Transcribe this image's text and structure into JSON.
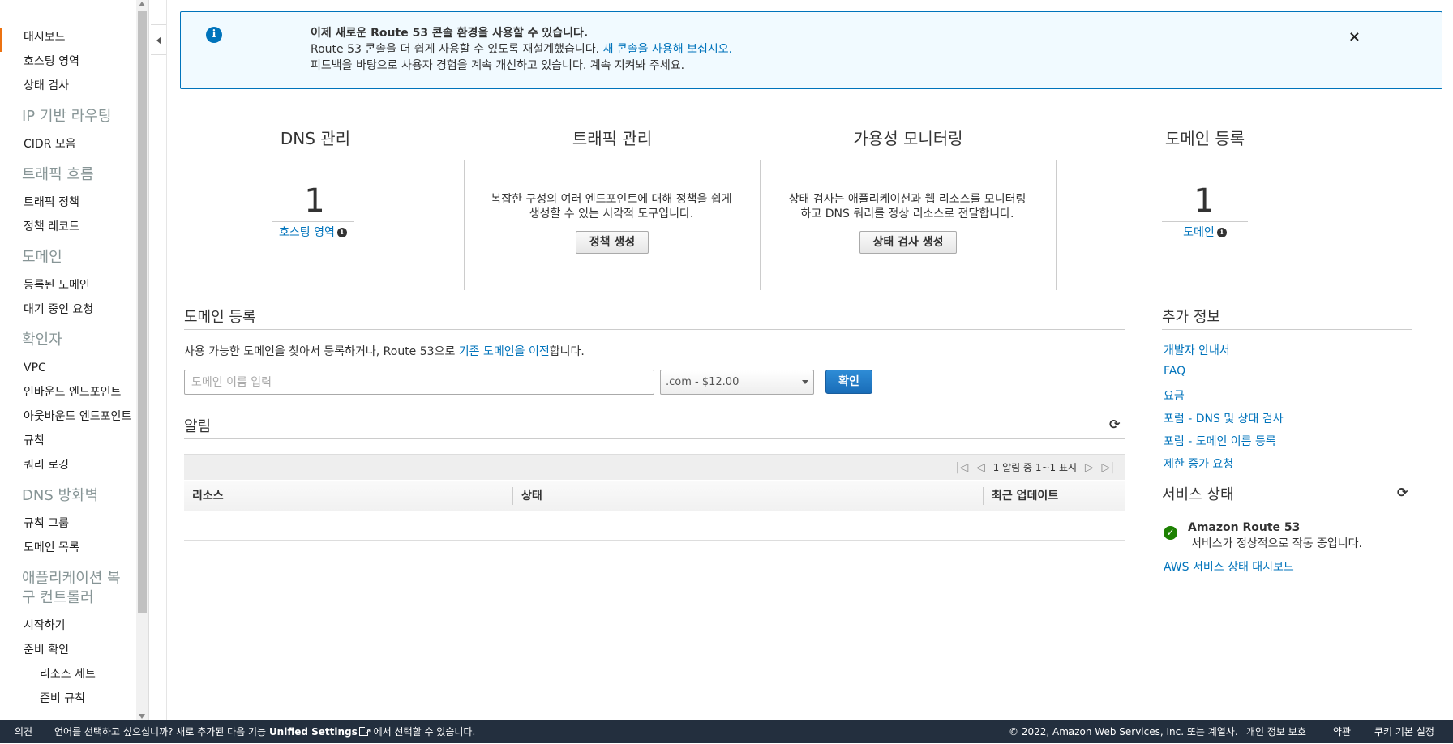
{
  "sidebar": {
    "dashboard": "대시보드",
    "hosted_zones": "호스팅 영역",
    "health_checks": "상태 검사",
    "sec_ip_routing": "IP 기반 라우팅",
    "cidr": "CIDR 모음",
    "sec_traffic_flow": "트래픽 흐름",
    "traffic_policies": "트래픽 정책",
    "policy_records": "정책 레코드",
    "sec_domains": "도메인",
    "registered_domains": "등록된 도메인",
    "pending_requests": "대기 중인 요청",
    "sec_resolver": "확인자",
    "vpc": "VPC",
    "inbound_endpoints": "인바운드 엔드포인트",
    "outbound_endpoints": "아웃바운드 엔드포인트",
    "rules": "규칙",
    "query_logging": "쿼리 로깅",
    "sec_dns_firewall": "DNS 방화벽",
    "rule_groups": "규칙 그룹",
    "domain_lists": "도메인 목록",
    "sec_arc": "애플리케이션 복구 컨트롤러",
    "getting_started": "시작하기",
    "readiness_check": "준비 확인",
    "resource_sets": "리소스 세트",
    "readiness_rules": "준비 규칙"
  },
  "banner": {
    "title": "이제 새로운 Route 53 콘솔 환경을 사용할 수 있습니다.",
    "line2_text": "Route 53 콘솔을 더 쉽게 사용할 수 있도록 재설계했습니다.",
    "line2_link": "새 콘솔을 사용해 보십시오.",
    "line3": "피드백을 바탕으로 사용자 경험을 계속 개선하고 있습니다. 계속 지켜봐 주세요.",
    "close": "×"
  },
  "features": {
    "dns": {
      "title": "DNS 관리",
      "count": "1",
      "link": "호스팅 영역"
    },
    "traffic": {
      "title": "트래픽 관리",
      "desc": "복잡한 구성의 여러 엔드포인트에 대해 정책을 쉽게 생성할 수 있는 시각적 도구입니다.",
      "button": "정책 생성"
    },
    "availability": {
      "title": "가용성 모니터링",
      "desc": "상태 검사는 애플리케이션과 웹 리소스를 모니터링하고 DNS 쿼리를 정상 리소스로 전달합니다.",
      "button": "상태 검사 생성"
    },
    "domain": {
      "title": "도메인 등록",
      "count": "1",
      "link": "도메인"
    }
  },
  "registration": {
    "title": "도메인 등록",
    "text_before": "사용 가능한 도메인을 찾아서 등록하거나, Route 53으로",
    "text_link": "기존 도메인을 이전",
    "text_after": "합니다.",
    "input_placeholder": "도메인 이름 입력",
    "tld_selected": ".com - $12.00",
    "confirm": "확인"
  },
  "alerts": {
    "title": "알림",
    "pager": "1 알림 중 1~1 표시",
    "columns": [
      "리소스",
      "상태",
      "최근 업데이트"
    ]
  },
  "more_info": {
    "title": "추가 정보",
    "links": [
      "개발자 안내서",
      "FAQ",
      "요금",
      "포럼 - DNS 및 상태 검사",
      "포럼 - 도메인 이름 등록",
      "제한 증가 요청"
    ]
  },
  "service_health": {
    "title": "서비스 상태",
    "service": "Amazon Route 53",
    "status": "서비스가 정상적으로 작동 중입니다.",
    "dashboard_link": "AWS 서비스 상태 대시보드"
  },
  "footer": {
    "feedback": "의견",
    "lang_text": "언어를 선택하고 싶으십니까? 새로 추가된 다음 기능",
    "unified": "Unified Settings",
    "lang_after": "에서 선택할 수 있습니다.",
    "copyright": "© 2022, Amazon Web Services, Inc. 또는 계열사.",
    "privacy": "개인 정보 보호",
    "terms": "약관",
    "cookies": "쿠키 기본 설정"
  },
  "colors": {
    "accent": "#ec7211",
    "link": "#0073bb",
    "footer_bg": "#232f3e",
    "success": "#1d8102"
  }
}
